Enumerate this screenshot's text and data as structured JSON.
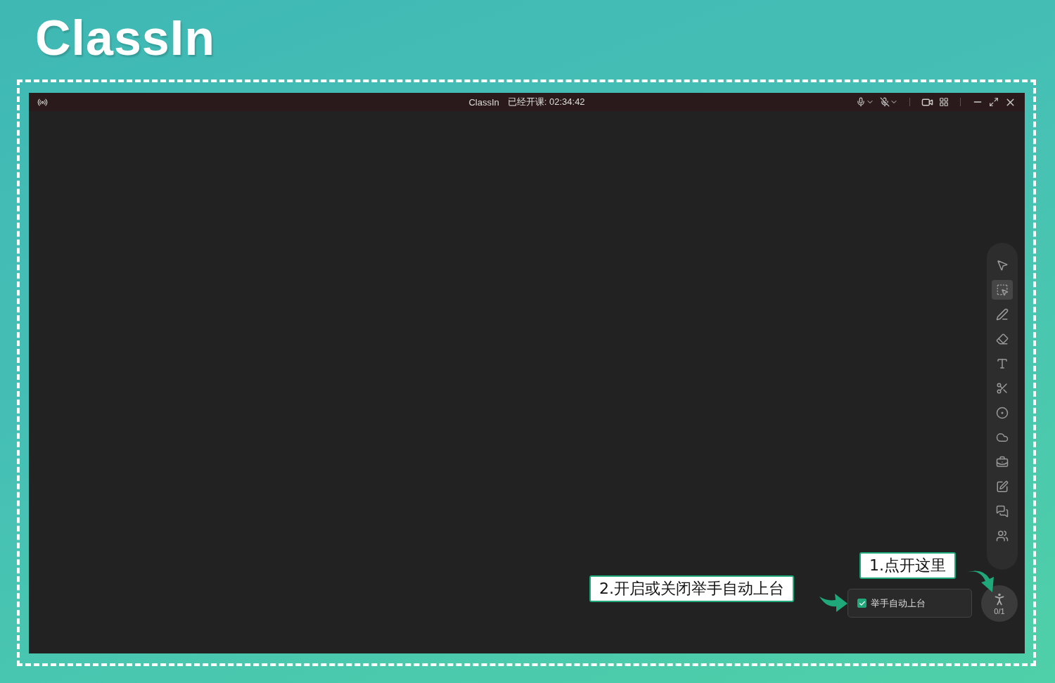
{
  "logo": {
    "text": "ClassIn"
  },
  "window": {
    "app_name": "ClassIn",
    "elapsed_label": "已经开课: 02:34:42"
  },
  "tools": [
    {
      "kind": "pointer",
      "selected": false
    },
    {
      "kind": "marquee",
      "selected": true
    },
    {
      "kind": "pen",
      "selected": false
    },
    {
      "kind": "eraser",
      "selected": false
    },
    {
      "kind": "text",
      "selected": false
    },
    {
      "kind": "scissors",
      "selected": false
    },
    {
      "kind": "recorder",
      "selected": false
    },
    {
      "kind": "cloud",
      "selected": false
    },
    {
      "kind": "toolbox",
      "selected": false
    },
    {
      "kind": "edit",
      "selected": false
    },
    {
      "kind": "chat",
      "selected": false
    },
    {
      "kind": "users",
      "selected": false
    }
  ],
  "hand_raise": {
    "count": "0/1"
  },
  "auto_stage": {
    "label": "举手自动上台",
    "checked": true
  },
  "callouts": [
    {
      "text": "1.点开这里"
    },
    {
      "text": "2.开启或关闭举手自动上台"
    }
  ]
}
